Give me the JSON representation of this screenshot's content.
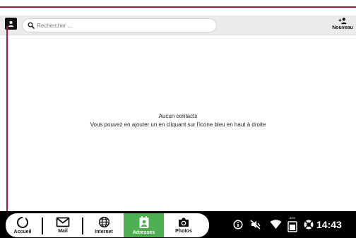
{
  "header": {
    "search_placeholder": "Rechercher ...",
    "new_label": "Nouveau"
  },
  "empty_state": {
    "line1": "Aucun contacts",
    "line2": "Vous pouvez en ajouter un en cliquant sur l'icone bleu en haut à droite"
  },
  "nav": {
    "home": "Accueil",
    "mail": "Mail",
    "internet": "Internet",
    "contacts": "Adresses",
    "photos": "Photos"
  },
  "status": {
    "battery_pct": "82%",
    "time": "14:43"
  },
  "colors": {
    "accent_line": "#a31b3f",
    "active_tab": "#4caf50",
    "taskbar": "#000000"
  }
}
